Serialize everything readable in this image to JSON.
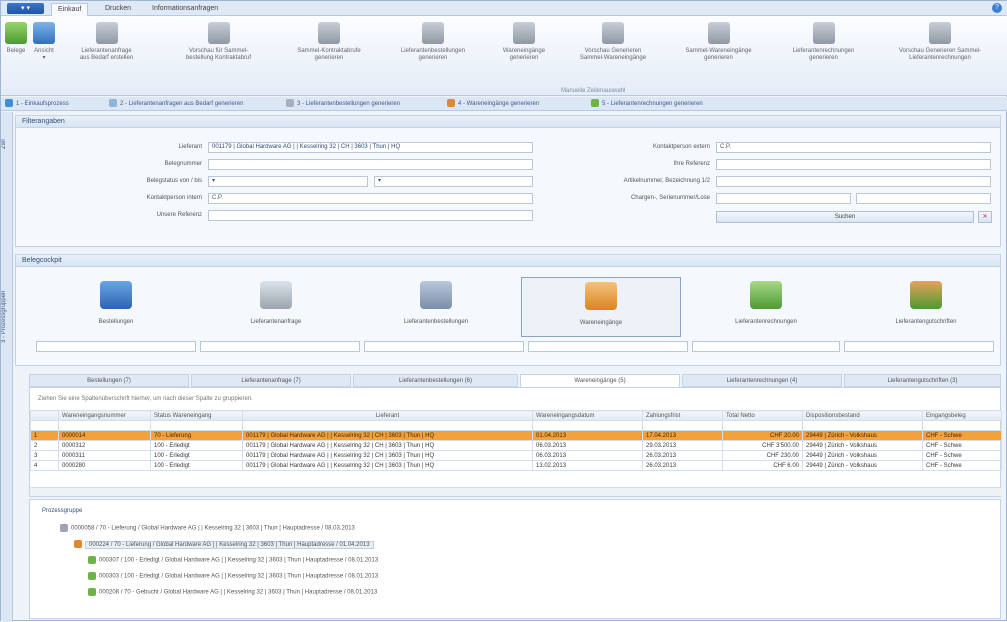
{
  "ribbon_tabs": {
    "app": "▾ ▾",
    "tabs": [
      "Einkauf",
      "Drucken",
      "Informationsanfragen"
    ]
  },
  "ribbon": {
    "buttons": [
      {
        "label": "Belege"
      },
      {
        "label": "Ansicht\n▾"
      },
      {
        "label": "Lieferantenanfrage\naus Bedarf erstellen"
      },
      {
        "label": "Vorschau für Sammel-\nbestellung Kontraktabruf"
      },
      {
        "label": "Sammel-Kontraktabrufe\ngenerieren"
      },
      {
        "label": "Lieferantenbestellungen\ngenerieren"
      },
      {
        "label": "Wareneingänge\ngenerieren"
      },
      {
        "label": "Vorschau Generieren\nSammel-Wareneingänge"
      },
      {
        "label": "Sammel-Wareneingänge\ngenerieren"
      },
      {
        "label": "Lieferantenrechnungen\ngenerieren"
      },
      {
        "label": "Vorschau Generieren Sammel-\nLieferantenrechnungen"
      }
    ],
    "group_label": "Manuelle Zeilenauswahl"
  },
  "steps": [
    "1 - Einkaufsprozess",
    "2 - Lieferantenanfragen aus Bedarf generieren",
    "3 - Lieferantenbestellungen generieren",
    "4 - Wareneingänge generieren",
    "5 - Lieferantenrechnungen generieren"
  ],
  "side": {
    "top": "Ziel",
    "bottom": "3 - Prozessgruppen"
  },
  "filter": {
    "title": "Filterangaben",
    "lieferant_label": "Lieferant",
    "lieferant_value": "001179 | Global Hardware AG | | Kesselring 32 | CH | 3603 | Thun | HQ",
    "belegnummer_label": "Belegnummer",
    "belegstatus_label": "Belegstatus von / bis",
    "kontaktperson_label": "Kontaktperson intern",
    "kontaktperson_value": "C.P.",
    "unsere_ref_label": "Unsere Referenz",
    "kontakt_extern_label": "Kontaktperson extern",
    "kontakt_extern_value": "C.P.",
    "ihre_ref_label": "Ihre Referenz",
    "artikel_label": "Artikelnummer, Bezeichnung 1/2",
    "chargen_label": "Chargen-, Serienummer/Lose",
    "search_label": "Suchen"
  },
  "workflow": {
    "title": "Belegcockpit",
    "cards": [
      "Bestellungen",
      "Lieferantenanfrage",
      "Lieferantenbestellungen",
      "Wareneingänge",
      "Lieferantenrechnungen",
      "Lieferantengutschriften"
    ]
  },
  "subtabs": [
    "Bestellungen (7)",
    "Lieferantenanfrage (7)",
    "Lieferantenbestellungen (6)",
    "Wareneingänge (5)",
    "Lieferantenrechnungen (4)",
    "Lieferantengutschriften (3)"
  ],
  "grid": {
    "hint": "Ziehen Sie eine Spaltenüberschrift hierher, um nach dieser Spalte zu gruppieren.",
    "columns": [
      "Wareneingangsnummer",
      "Status Wareneingang",
      "Lieferant",
      "Wareneingangsdatum",
      "Zahlungsfrist",
      "Total Netto",
      "Dispositionsbestand",
      "Eingangsbeleg"
    ],
    "rows": [
      {
        "no": "1",
        "nr": "0000014",
        "status": "70 - Lieferung",
        "lief": "001179 | Global Hardware AG | | Kesselring 32 | CH | 3603 | Thun | HQ",
        "datum": "01.04.2013",
        "frist": "17.04.2013",
        "total": "CHF 20.00",
        "disp": "29449 | Zürich - Volkshaus",
        "eing": "CHF - Schwe"
      },
      {
        "no": "2",
        "nr": "0000312",
        "status": "100 - Erledigt",
        "lief": "001179 | Global Hardware AG | | Kesselring 32 | CH | 3603 | Thun | HQ",
        "datum": "06.03.2013",
        "frist": "29.03.2013",
        "total": "CHF 3'500.00",
        "disp": "29449 | Zürich - Volkshaus",
        "eing": "CHF - Schwe"
      },
      {
        "no": "3",
        "nr": "0000311",
        "status": "100 - Erledigt",
        "lief": "001179 | Global Hardware AG | | Kesselring 32 | CH | 3603 | Thun | HQ",
        "datum": "06.03.2013",
        "frist": "26.03.2013",
        "total": "CHF 230.00",
        "disp": "29449 | Zürich - Volkshaus",
        "eing": "CHF - Schwe"
      },
      {
        "no": "4",
        "nr": "0000280",
        "status": "100 - Erledigt",
        "lief": "001179 | Global Hardware AG | | Kesselring 32 | CH | 3603 | Thun | HQ",
        "datum": "13.02.2013",
        "frist": "26.03.2013",
        "total": "CHF 6.00",
        "disp": "29449 | Zürich - Volkshaus",
        "eing": "CHF - Schwe"
      }
    ]
  },
  "tree": {
    "title": "Prozessgruppe",
    "lines": [
      "0000058 / 70 - Lieferung / Global Hardware AG | | Kesselring 32 | 3603 | Thun | Hauptadresse / 08.03.2013",
      "000224 / 70 - Lieferung / Global Hardware AG | | Kesselring 32 | 3603 | Thun | Hauptadresse / 01.04.2013",
      "000307 / 100 - Erledigt / Global Hardware AG | | Kesselring 32 | 3603 | Thun | Hauptadresse / 08.01.2013",
      "000303 / 100 - Erledigt / Global Hardware AG | | Kesselring 32 | 3603 | Thun | Hauptadresse / 08.01.2013",
      "000208 / 70 - Gebucht / Global Hardware AG | | Kesselring 32 | 3603 | Thun | Hauptadresse / 08.01.2013"
    ]
  }
}
